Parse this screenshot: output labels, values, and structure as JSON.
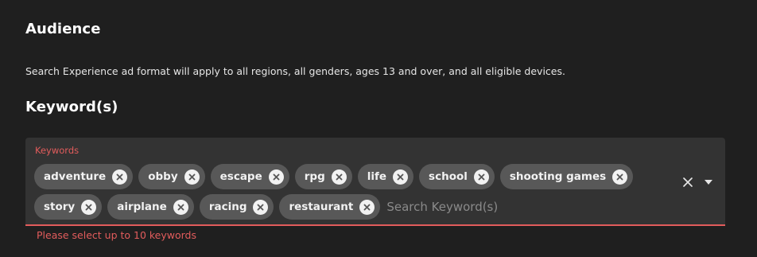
{
  "audience": {
    "title": "Audience",
    "description": "Search Experience ad format will apply to all regions, all genders, ages 13 and over, and all eligible devices."
  },
  "keywords": {
    "title": "Keyword(s)",
    "field_label": "Keywords",
    "chips": [
      {
        "label": "adventure"
      },
      {
        "label": "obby"
      },
      {
        "label": "escape"
      },
      {
        "label": "rpg"
      },
      {
        "label": "life"
      },
      {
        "label": "school"
      },
      {
        "label": "shooting games"
      },
      {
        "label": "story"
      },
      {
        "label": "airplane"
      },
      {
        "label": "racing"
      },
      {
        "label": "restaurant"
      }
    ],
    "search_placeholder": "Search Keyword(s)",
    "search_value": "",
    "error": "Please select up to 10 keywords"
  },
  "icons": {
    "chip_remove": "close-circle-icon",
    "clear": "close-icon",
    "dropdown": "caret-down-icon"
  },
  "colors": {
    "background": "#1f1f1f",
    "field_background": "#333333",
    "chip_background": "#585858",
    "error": "#e25c5c"
  }
}
